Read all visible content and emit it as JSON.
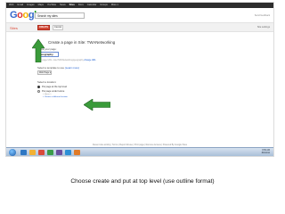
{
  "gbar": {
    "links": [
      "Web",
      "Gmail",
      "Images",
      "Maps",
      "YouTube",
      "News",
      "Sites",
      "Docs",
      "Calendar",
      "Groups",
      "More ▾"
    ],
    "active_index": 6
  },
  "header": {
    "logo_letters": [
      "G",
      "o",
      "o",
      "g",
      "l",
      "e"
    ],
    "logo_colors": [
      "#3366cc",
      "#dd3333",
      "#f4b400",
      "#3366cc",
      "#109618",
      "#dd3333"
    ],
    "search_value": "Search my sites",
    "top_right": "Send feedback"
  },
  "product_bar": {
    "product_name": "Sites",
    "create_label": "CREATE",
    "cancel_label": "Cancel",
    "right_text": "Site settings"
  },
  "form": {
    "page_heading": "Create a page in Site: TWANetworking",
    "name_label": "Name your page:",
    "name_value": "Geography",
    "url_text": "Your page URL: /site/TWANetworking/geography",
    "url_change": "change URL",
    "template_label": "Select a template to use",
    "template_link": "(Learn more)",
    "template_value": "Web Page ▾",
    "location_label": "Select a location:",
    "location_options": [
      "Put page at the top level",
      "Put page under Home"
    ],
    "location_selected": 0,
    "sub_path": "» Home »",
    "sub_choose": "» Choose a different location"
  },
  "footer": "Recent site activity | Terms | Report Abuse | Print page | Remove Access | Powered By Google Sites",
  "taskbar": {
    "icon_colors": [
      "#2f78c4",
      "#f2b134",
      "#d94a3a",
      "#3b9c4a",
      "#6b4fa0",
      "#2c8fd6",
      "#e07b28"
    ],
    "time": "9:56 AM",
    "date": "8/6/2012"
  },
  "accent": {
    "arrow_color": "#3a9b3a",
    "create_button_color": "#d14836"
  },
  "caption": "Choose create and put at top level (use outline format)"
}
